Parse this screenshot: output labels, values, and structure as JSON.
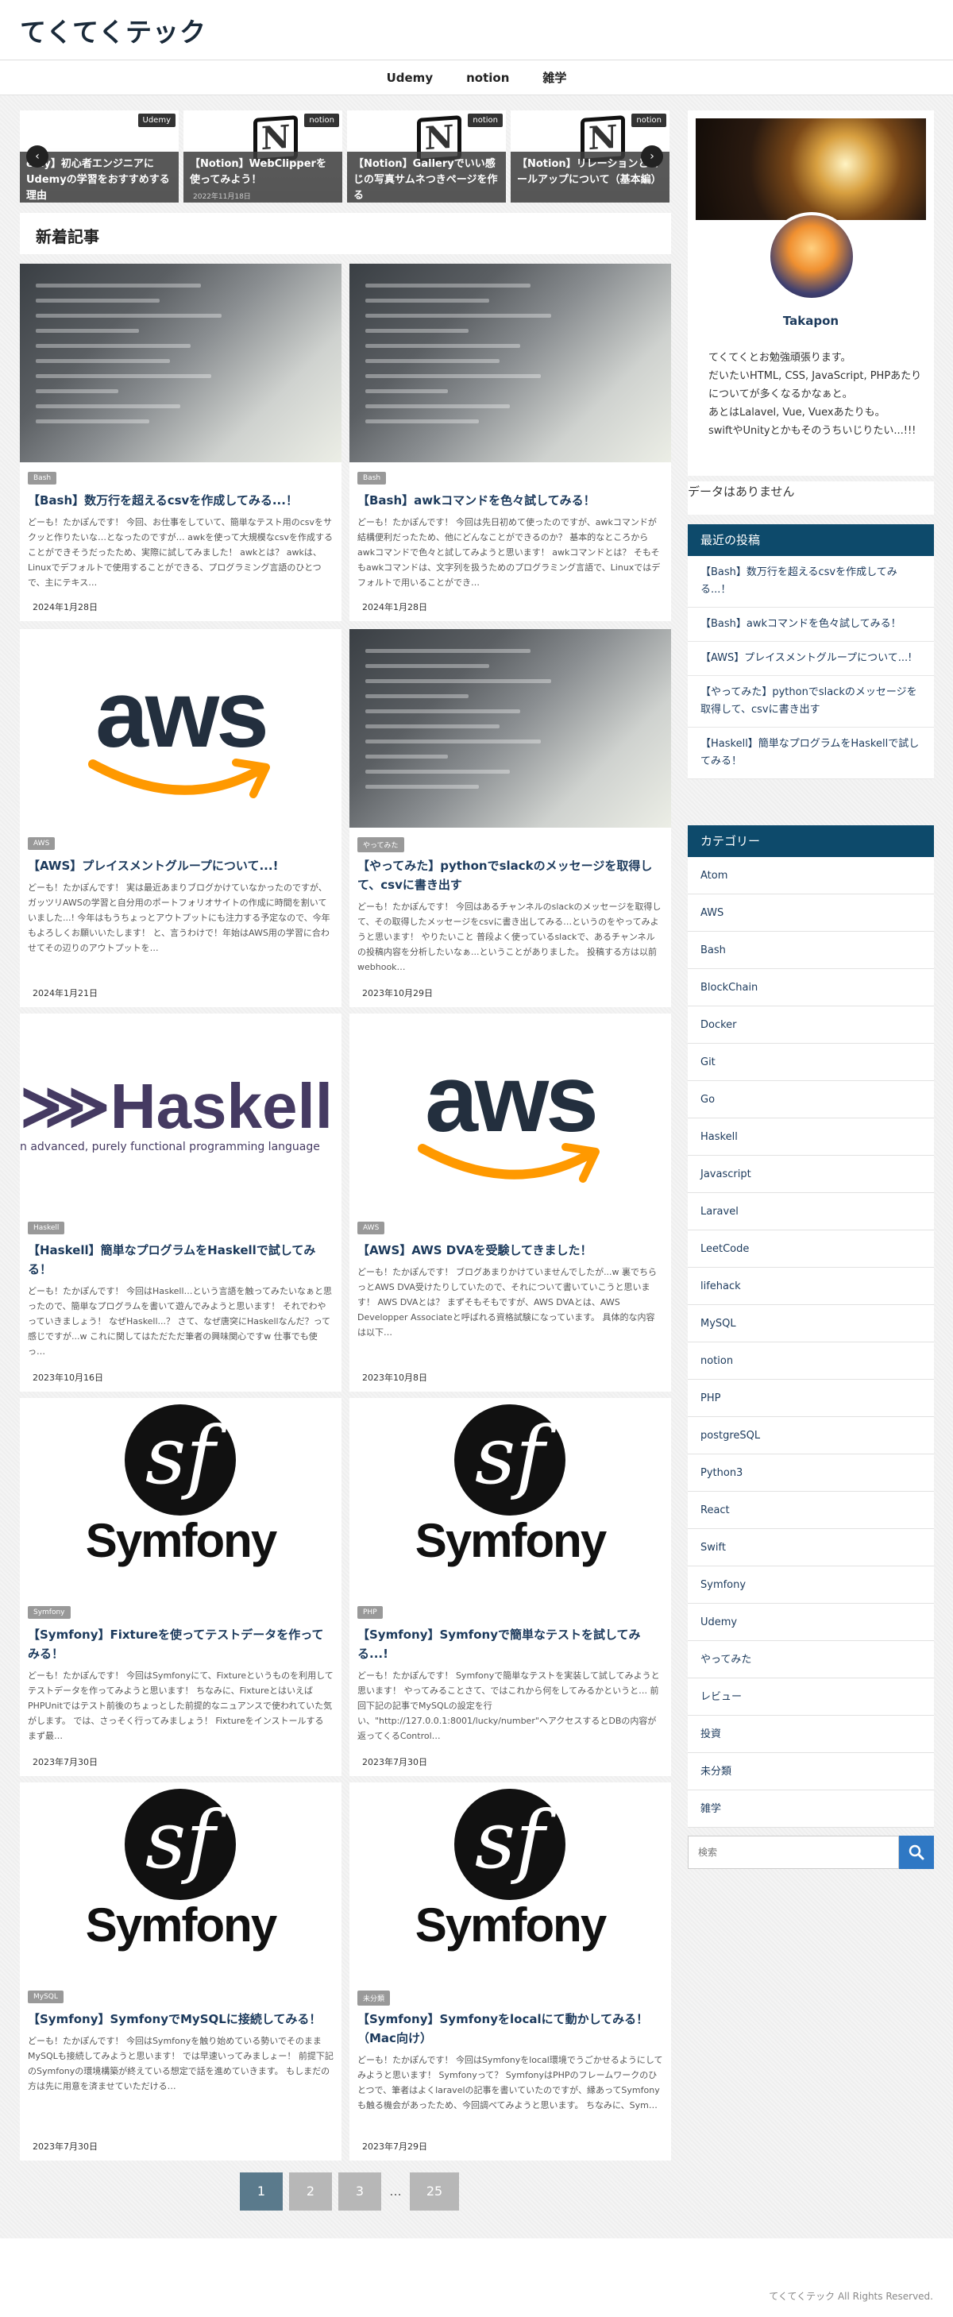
{
  "site": {
    "title": "てくてくテック"
  },
  "nav": [
    "Udemy",
    "notion",
    "雑学"
  ],
  "slider": {
    "slides": [
      {
        "category": "Udemy",
        "caption": "emy】初心者エンジニアにUdemyの学習をおすすめする理由"
      },
      {
        "category": "notion",
        "caption": "【Notion】WebClipperを使ってみよう！",
        "date": "2022年11月18日"
      },
      {
        "category": "notion",
        "caption": "【Notion】Galleryでいい感じの写真サムネつきページを作る"
      },
      {
        "category": "notion",
        "caption": "【Notion】リレーションとロールアップについて（基本編）"
      }
    ]
  },
  "section_title": "新着記事",
  "posts": [
    {
      "img": "code",
      "tag": "Bash",
      "title": "【Bash】数万行を超えるcsvを作成してみる...！",
      "excerpt": "どーも！たかぽんです！ 今回、お仕事をしていて、簡単なテスト用のcsvをサクッと作りたいな…となったのですが… awkを使って大規模なcsvを作成することができそうだったため、実際に試してみました！ awkとは？ awkは、Linuxでデフォルトで使用することができる、プログラミング言語のひとつで、主にテキス…",
      "date": "2024年1月28日"
    },
    {
      "img": "code",
      "tag": "Bash",
      "title": "【Bash】awkコマンドを色々試してみる！",
      "excerpt": "どーも！たかぽんです！ 今回は先日初めて使ったのですが、awkコマンドが結構便利だったため、他にどんなことができるのか？ 基本的なところからawkコマンドで色々と試してみようと思います！ awkコマンドとは？ そもそもawkコマンドは、文字列を扱うためのプログラミング言語で、Linuxではデフォルトで用いることができ…",
      "date": "2024年1月28日"
    },
    {
      "img": "aws",
      "tag": "AWS",
      "title": "【AWS】プレイスメントグループについて...!",
      "excerpt": "どーも！たかぽんです！ 実は最近あまりブログかけていなかったのですが、ガッツリAWSの学習と自分用のポートフォリオサイトの作成に時間を割いていました...! 今年はもうちょっとアウトプットにも注力する予定なので、今年もよろしくお願いいたします！ と、言うわけで！年始はAWS用の学習に合わせてその辺りのアウトプットを…",
      "date": "2024年1月21日"
    },
    {
      "img": "code",
      "tag": "やってみた",
      "title": "【やってみた】pythonでslackのメッセージを取得して、csvに書き出す",
      "excerpt": "どーも！たかぽんです！ 今回はあるチャンネルのslackのメッセージを取得して、その取得したメッセージをcsvに書き出してみる…というのをやってみようと思います！ やりたいこと 普段よく使っているslackで、あるチャンネルの投稿内容を分析したいなぁ...ということがありました。 投稿する方は以前webhook…",
      "date": "2023年10月29日"
    },
    {
      "img": "haskell",
      "tag": "Haskell",
      "title": "【Haskell】簡単なプログラムをHaskellで試してみる！",
      "excerpt": "どーも！たかぽんです！ 今回はHaskell…という言語を触ってみたいなぁと思ったので、簡単なプログラムを書いて遊んでみようと思います！ それでわやっていきましょう！ なぜHaskell...？ さて、なぜ唐突にHaskellなんだ？って感じですが...w これに関してはただただ筆者の興味関心ですw 仕事でも使っ…",
      "date": "2023年10月16日"
    },
    {
      "img": "aws",
      "tag": "AWS",
      "title": "【AWS】AWS DVAを受験してきました！",
      "excerpt": "どーも！たかぽんです！ ブログあまりかけていませんでしたが...w 裏でちらっとAWS DVA受けたりしていたので、それについて書いていこうと思います！ AWS DVAとは？ まずそもそもですが、AWS DVAとは、AWS Developper Associateと呼ばれる資格試験になっています。 具体的な内容は以下…",
      "date": "2023年10月8日"
    },
    {
      "img": "symfony",
      "tag": "Symfony",
      "title": "【Symfony】Fixtureを使ってテストデータを作ってみる！",
      "excerpt": "どーも！たかぽんです！ 今回はSymfonyにて、Fixtureというものを利用してテストデータを作ってみようと思います！ ちなみに、Fixtureとはいえば PHPUnitではテスト前後のちょっとした前提的なニュアンスで使われていた気がします。 では、さっそく行ってみましょう！ Fixtureをインストールする まず最…",
      "date": "2023年7月30日"
    },
    {
      "img": "symfony",
      "tag": "PHP",
      "title": "【Symfony】Symfonyで簡単なテストを試してみる...!",
      "excerpt": "どーも！たかぽんです！ Symfonyで簡単なテストを実装して試してみようと思います！ やってみることさて、ではこれから何をしてみるかというと… 前回下記の記事でMySQLの設定を行い、\"http://127.0.0.1:8001/lucky/number\"へアクセスするとDBの内容が返ってくるControl…",
      "date": "2023年7月30日"
    },
    {
      "img": "symfony",
      "tag": "MySQL",
      "title": "【Symfony】SymfonyでMySQLに接続してみる！",
      "excerpt": "どーも！たかぽんです！ 今回はSymfonyを触り始めている勢いでそのままMySQLも接続してみようと思います！ では早速いってみましょー！ 前提下記のSymfonyの環境構築が終えている想定で話を進めていきます。 もしまだの方は先に用意を済ませていただける…",
      "date": "2023年7月30日"
    },
    {
      "img": "symfony",
      "tag": "未分類",
      "title": "【Symfony】Symfonyをlocalにて動かしてみる！（Mac向け）",
      "excerpt": "どーも！たかぽんです！ 今回はSymfonyをlocal環境でうごかせるようにしてみようと思います！ Symfonyって？ SymfonyはPHPのフレームワークのひとつで、筆者はよくlaravelの記事を書いていたのですが、縁あってSymfonyも触る機会があったため、今回調べてみようと思います。 ちなみに、Sym…",
      "date": "2023年7月29日"
    }
  ],
  "profile": {
    "name": "Takapon",
    "bio": [
      "てくてくとお勉強頑張ります。",
      "だいたいHTML, CSS, JavaScript, PHPあたりについてが多くなるかなぁと。",
      "あとはLalavel, Vue, Vuexあたりも。",
      "swiftやUnityとかもそのうちいじりたい...!!!"
    ]
  },
  "no_data": "データはありません",
  "recent": {
    "heading": "最近の投稿",
    "items": [
      "【Bash】数万行を超えるcsvを作成してみる...！",
      "【Bash】awkコマンドを色々試してみる！",
      "【AWS】プレイスメントグループについて...!",
      "【やってみた】pythonでslackのメッセージを取得して、csvに書き出す",
      "【Haskell】簡単なプログラムをHaskellで試してみる！"
    ]
  },
  "categories": {
    "heading": "カテゴリー",
    "items": [
      "Atom",
      "AWS",
      "Bash",
      "BlockChain",
      "Docker",
      "Git",
      "Go",
      "Haskell",
      "Javascript",
      "Laravel",
      "LeetCode",
      "lifehack",
      "MySQL",
      "notion",
      "PHP",
      "postgreSQL",
      "Python3",
      "React",
      "Swift",
      "Symfony",
      "Udemy",
      "やってみた",
      "レビュー",
      "投資",
      "未分類",
      "雑学"
    ]
  },
  "search": {
    "placeholder": "検索"
  },
  "pagination": [
    "1",
    "2",
    "3",
    "...",
    "25"
  ],
  "footer": "てくてくテック All Rights Reserved."
}
